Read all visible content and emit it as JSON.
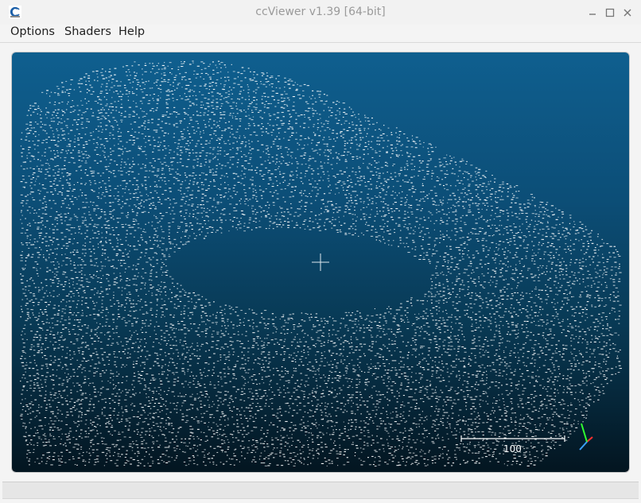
{
  "window": {
    "title": "ccViewer v1.39 [64-bit]",
    "app_icon": "cloudcompare-logo-icon",
    "controls": {
      "minimize": "–",
      "maximize": "☐",
      "close": "✕"
    }
  },
  "menu": {
    "items": [
      {
        "label": "Options"
      },
      {
        "label": "Shaders"
      },
      {
        "label": "Help"
      }
    ]
  },
  "viewport": {
    "background_top": "#0f5f8f",
    "background_bottom": "#031520",
    "point_color": "#ffffff",
    "scale_bar": {
      "value": "100"
    },
    "axis_gizmo_colors": {
      "x": "#ff3030",
      "y": "#30ff30",
      "z": "#3aa0ff"
    }
  },
  "statusbar": {
    "text": ""
  }
}
